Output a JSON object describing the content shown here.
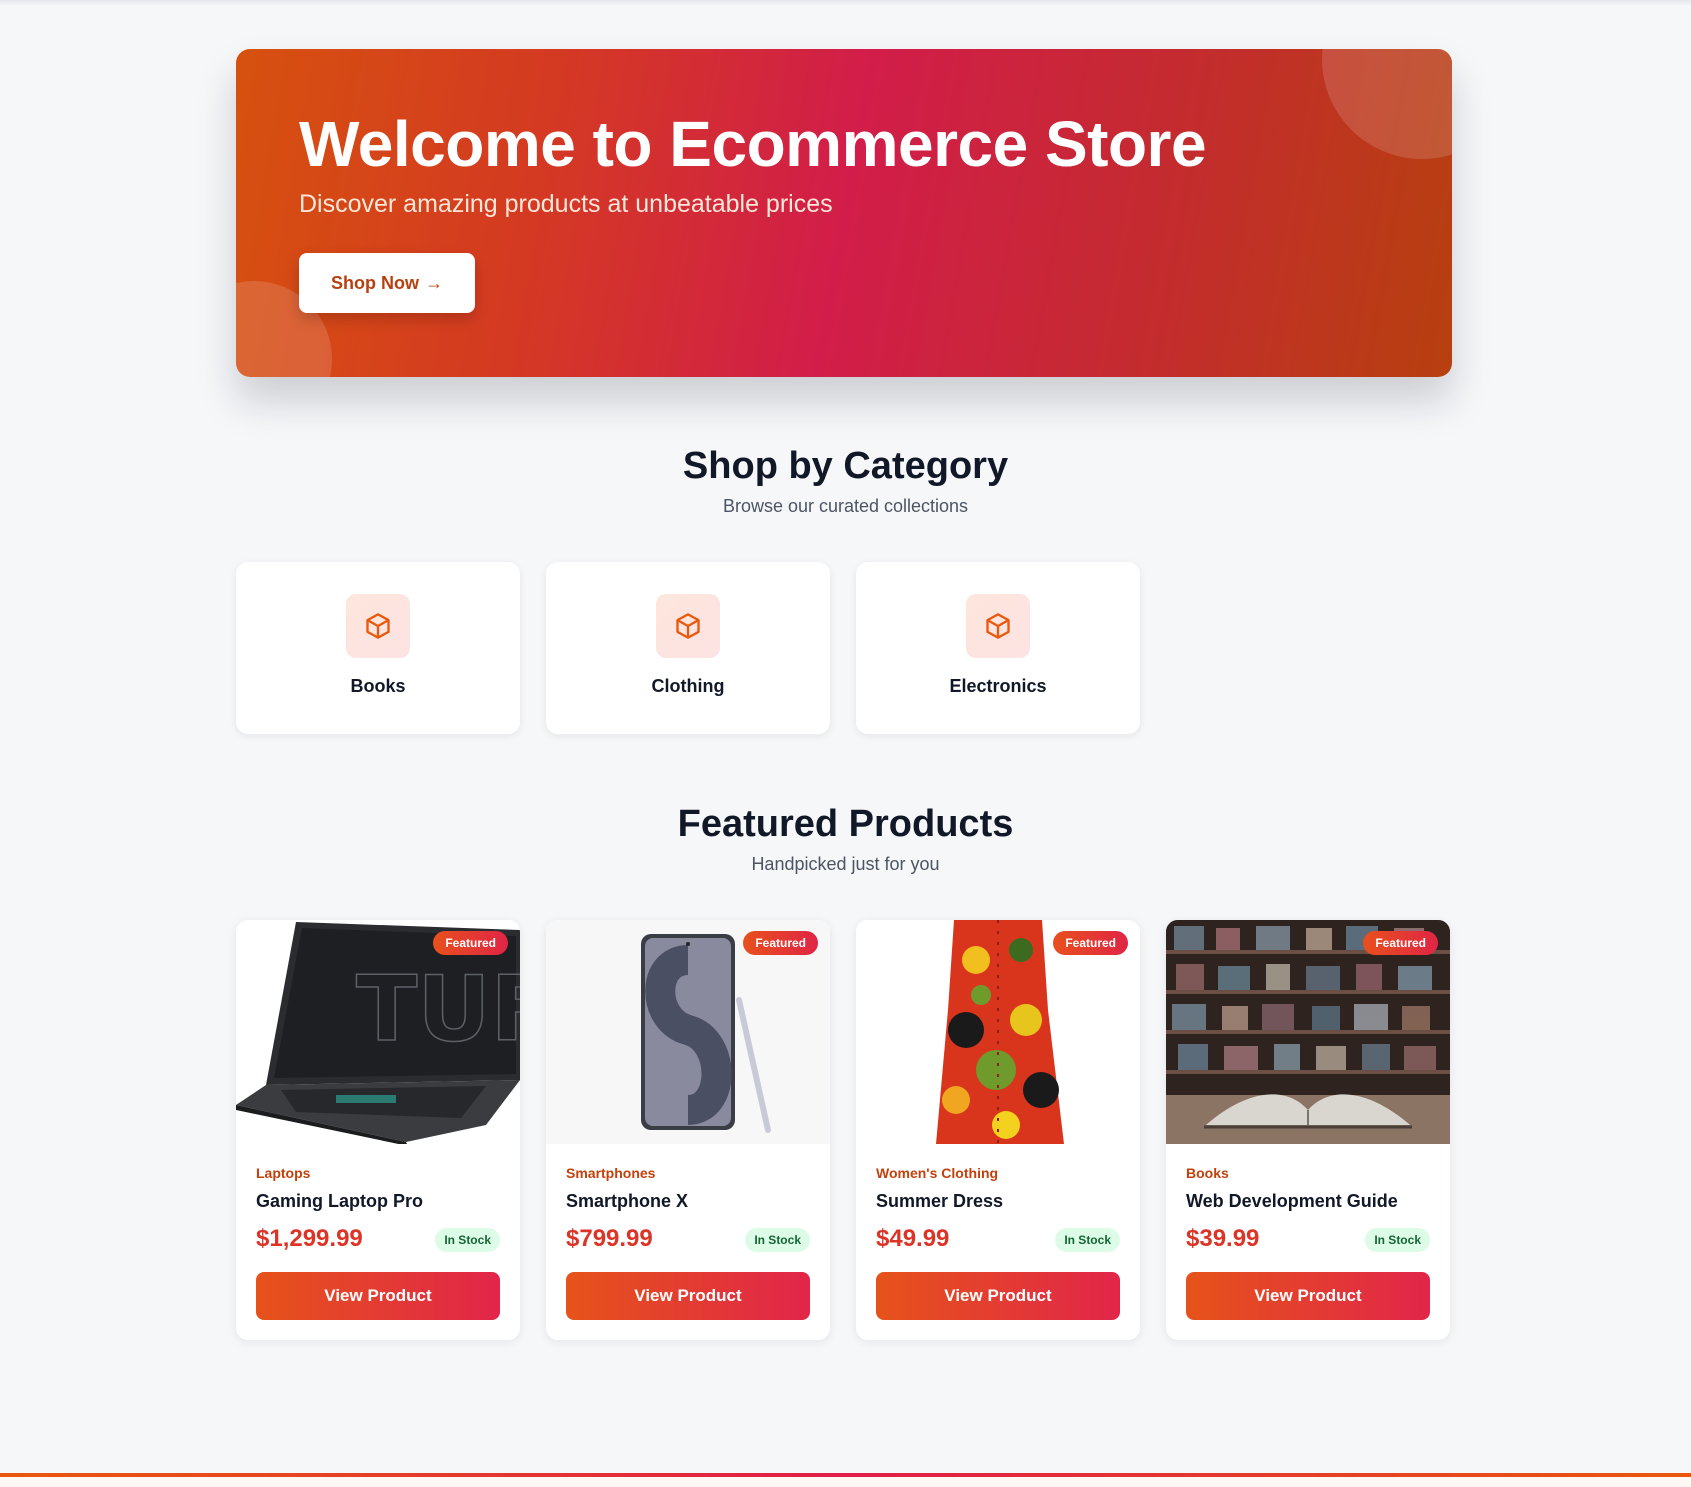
{
  "hero": {
    "title": "Welcome to Ecommerce Store",
    "subtitle": "Discover amazing products at unbeatable prices",
    "cta_label": "Shop Now",
    "cta_arrow": "→"
  },
  "categories_section": {
    "title": "Shop by Category",
    "subtitle": "Browse our curated collections",
    "icon": "box-icon",
    "items": [
      {
        "label": "Books"
      },
      {
        "label": "Clothing"
      },
      {
        "label": "Electronics"
      }
    ]
  },
  "featured_section": {
    "title": "Featured Products",
    "subtitle": "Handpicked just for you",
    "products": [
      {
        "badge": "Featured",
        "category": "Laptops",
        "name": "Gaming Laptop Pro",
        "price": "$1,299.99",
        "stock": "In Stock",
        "button": "View Product",
        "image": "laptop-image"
      },
      {
        "badge": "Featured",
        "category": "Smartphones",
        "name": "Smartphone X",
        "price": "$799.99",
        "stock": "In Stock",
        "button": "View Product",
        "image": "smartphone-image"
      },
      {
        "badge": "Featured",
        "category": "Women's Clothing",
        "name": "Summer Dress",
        "price": "$49.99",
        "stock": "In Stock",
        "button": "View Product",
        "image": "dress-image"
      },
      {
        "badge": "Featured",
        "category": "Books",
        "name": "Web Development Guide",
        "price": "$39.99",
        "stock": "In Stock",
        "button": "View Product",
        "image": "book-image"
      }
    ]
  },
  "colors": {
    "accent": "#ea580c",
    "accent_secondary": "#e11d48",
    "background": "#f6f7f9",
    "stock_badge_bg": "#dcfce7",
    "stock_badge_text": "#166534"
  }
}
